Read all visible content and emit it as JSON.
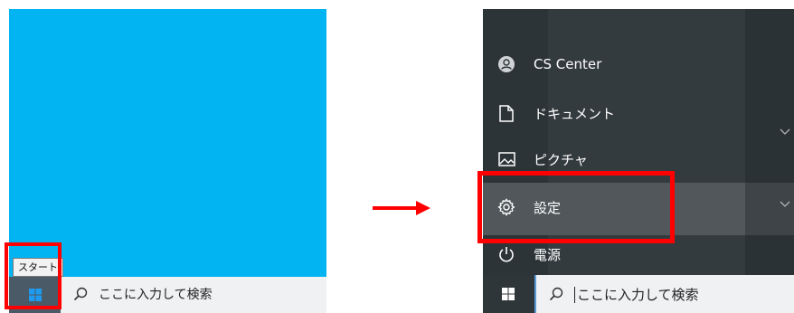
{
  "left": {
    "tooltip": "スタート",
    "search_placeholder": "ここに入力して検索",
    "desktop_color": "#02b4f2",
    "start_icon": "windows-logo-icon",
    "search_icon": "search-icon"
  },
  "right": {
    "menu_items": [
      {
        "label": "CS Center",
        "icon": "user-account-icon"
      },
      {
        "label": "ドキュメント",
        "icon": "document-icon"
      },
      {
        "label": "ピクチャ",
        "icon": "picture-icon"
      },
      {
        "label": "設定",
        "icon": "gear-icon"
      },
      {
        "label": "電源",
        "icon": "power-icon"
      }
    ],
    "search_placeholder": "ここに入力して検索",
    "start_icon": "windows-logo-icon",
    "search_icon": "search-icon"
  },
  "colors": {
    "highlight": "#ff0000",
    "menu_bg": "#343b3f",
    "taskbar_bg": "#f0f1f3"
  }
}
